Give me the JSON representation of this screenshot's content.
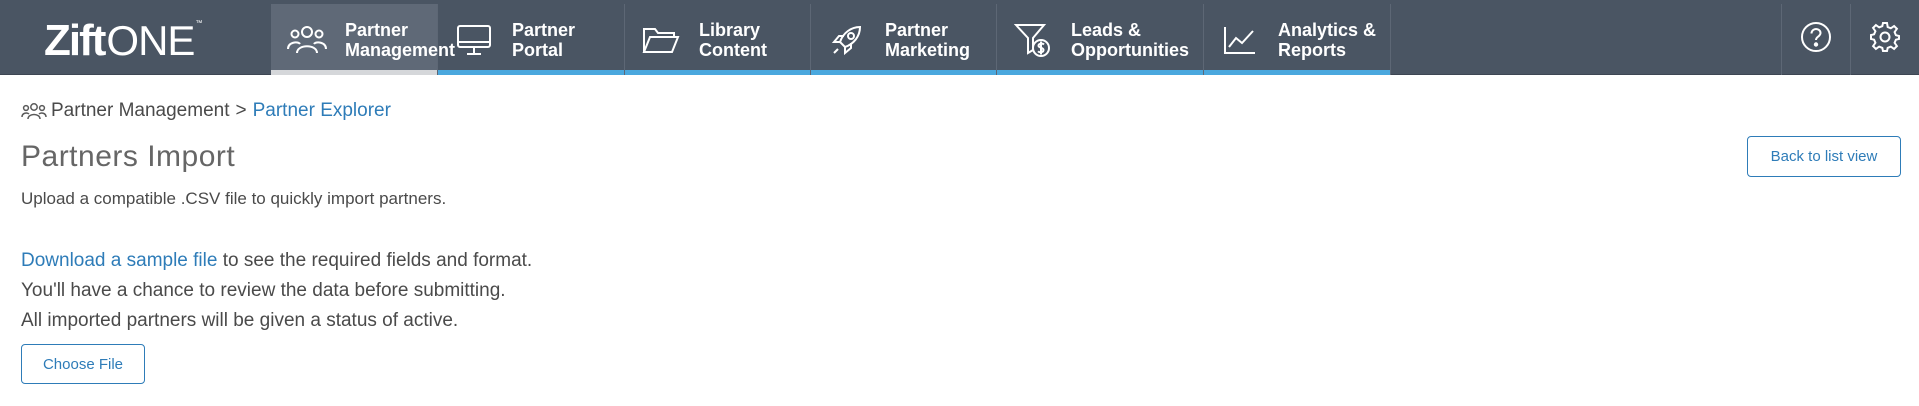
{
  "logo": {
    "brand": "Zift",
    "suffix": "ONE",
    "tm": "™"
  },
  "nav": [
    {
      "label": "Partner\nManagement",
      "icon": "people-group-icon",
      "active": true
    },
    {
      "label": "Partner\nPortal",
      "icon": "monitor-icon",
      "active": false
    },
    {
      "label": "Library\nContent",
      "icon": "folder-icon",
      "active": false
    },
    {
      "label": "Partner\nMarketing",
      "icon": "rocket-icon",
      "active": false
    },
    {
      "label": "Leads &\nOpportunities",
      "icon": "funnel-dollar-icon",
      "active": false
    },
    {
      "label": "Analytics &\nReports",
      "icon": "line-chart-icon",
      "active": false
    }
  ],
  "header_icons": {
    "help": "help-circle-icon",
    "settings": "gear-icon"
  },
  "breadcrumb": {
    "parent": "Partner Management",
    "separator": ">",
    "current": "Partner Explorer",
    "icon": "people-group-icon"
  },
  "page": {
    "title": "Partners Import",
    "subtitle": "Upload a compatible .CSV file to quickly import partners.",
    "download_link": "Download a sample file",
    "download_rest": " to see the required fields and format.",
    "line2": "You'll have a chance to review the data before submitting.",
    "line3": "All imported partners will be given a status of active.",
    "back_button": "Back to list view",
    "choose_button": "Choose File"
  },
  "colors": {
    "header_bg": "#4a5563",
    "active_tab_bg": "#5f6977",
    "accent_blue": "#4aa8de",
    "link": "#2e7cb8"
  }
}
